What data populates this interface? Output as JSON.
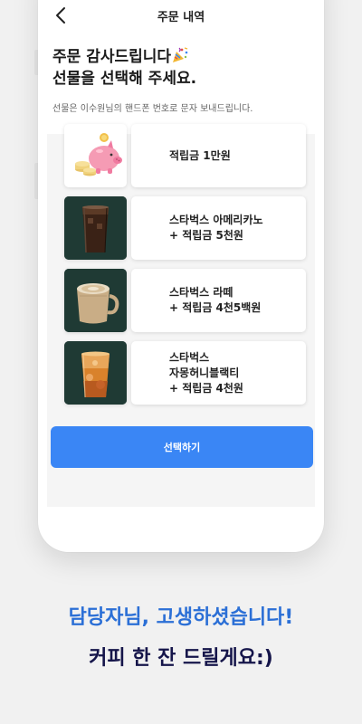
{
  "nav": {
    "title": "주문 내역"
  },
  "header": {
    "headline_line1": "주문 감사드립니다",
    "headline_line2": "선물을 선택해 주세요.",
    "subtext": "선물은 이수원님의 핸드폰 번호로 문자 보내드립니다."
  },
  "options": [
    {
      "lines": [
        "적립금 1만원"
      ],
      "image": "piggy-bank"
    },
    {
      "lines": [
        "스타벅스 아메리카노",
        "+ 적립금 5천원"
      ],
      "image": "iced-americano"
    },
    {
      "lines": [
        "스타벅스 라떼",
        "+ 적립금 4천5백원"
      ],
      "image": "latte"
    },
    {
      "lines": [
        "스타벅스",
        "자몽허니블랙티",
        "+ 적립금 4천원"
      ],
      "image": "grapefruit-honey-black-tea"
    }
  ],
  "select_button": {
    "label": "선택하기"
  },
  "captions": {
    "line1": "담당자님, 고생하셨습니다!",
    "line2": "커피 한 잔 드릴게요:)"
  },
  "colors": {
    "accent": "#3a86f5",
    "caption_blue": "#2b6fd6",
    "caption_navy": "#15154a",
    "thumb_dark": "#1f3a34"
  }
}
